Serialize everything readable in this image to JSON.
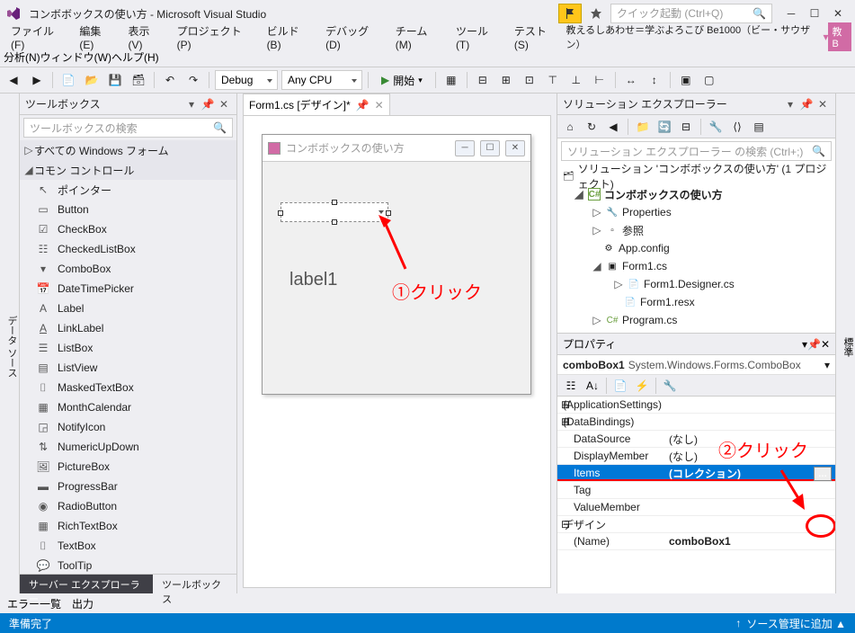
{
  "title": "コンボボックスの使い方 - Microsoft Visual Studio",
  "quick_launch_placeholder": "クイック起動 (Ctrl+Q)",
  "menu": {
    "file": "ファイル(F)",
    "edit": "編集(E)",
    "view": "表示(V)",
    "project": "プロジェクト(P)",
    "build": "ビルド(B)",
    "debug": "デバッグ(D)",
    "team": "チーム(M)",
    "tools": "ツール(T)",
    "test": "テスト(S)",
    "analyze": "分析(N)",
    "window": "ウィンドウ(W)",
    "help": "ヘルプ(H)"
  },
  "tagline": "教えるしあわせ＝学ぶよろこび Be1000（ビー・サウザン）",
  "tag_badge": "教B",
  "toolbar": {
    "config": "Debug",
    "platform": "Any CPU",
    "start": "開始"
  },
  "side_rail_left": "データ ソース",
  "side_rail_right": "標準",
  "toolbox": {
    "title": "ツールボックス",
    "search_placeholder": "ツールボックスの検索",
    "group1": "すべての Windows フォーム",
    "group2": "コモン コントロール",
    "items": [
      "ポインター",
      "Button",
      "CheckBox",
      "CheckedListBox",
      "ComboBox",
      "DateTimePicker",
      "Label",
      "LinkLabel",
      "ListBox",
      "ListView",
      "MaskedTextBox",
      "MonthCalendar",
      "NotifyIcon",
      "NumericUpDown",
      "PictureBox",
      "ProgressBar",
      "RadioButton",
      "RichTextBox",
      "TextBox",
      "ToolTip"
    ],
    "tab_inactive": "サーバー エクスプローラー",
    "tab_active": "ツールボックス"
  },
  "doc_tab": "Form1.cs [デザイン]*",
  "form": {
    "title": "コンボボックスの使い方",
    "label1": "label1"
  },
  "annotations": {
    "click1": "①クリック",
    "click2": "②クリック"
  },
  "solution": {
    "title": "ソリューション エクスプローラー",
    "search_placeholder": "ソリューション エクスプローラー の検索 (Ctrl+;)",
    "root": "ソリューション 'コンボボックスの使い方' (1 プロジェクト)",
    "project": "コンボボックスの使い方",
    "nodes": {
      "properties": "Properties",
      "refs": "参照",
      "appconfig": "App.config",
      "form1": "Form1.cs",
      "designer": "Form1.Designer.cs",
      "resx": "Form1.resx",
      "program": "Program.cs"
    }
  },
  "properties": {
    "title": "プロパティ",
    "object_name": "comboBox1",
    "object_type": "System.Windows.Forms.ComboBox",
    "rows": {
      "app_settings": "(ApplicationSettings)",
      "data_bindings": "(DataBindings)",
      "data_source_k": "DataSource",
      "data_source_v": "(なし)",
      "display_member_k": "DisplayMember",
      "display_member_v": "(なし)",
      "items_k": "Items",
      "items_v": "(コレクション)",
      "tag_k": "Tag",
      "value_member_k": "ValueMember",
      "design_group": "デザイン",
      "name_k": "(Name)",
      "name_v": "comboBox1"
    }
  },
  "bottom_tabs": {
    "errors": "エラー一覧",
    "output": "出力"
  },
  "status": {
    "left": "準備完了",
    "right": "ソース管理に追加 ▲"
  }
}
